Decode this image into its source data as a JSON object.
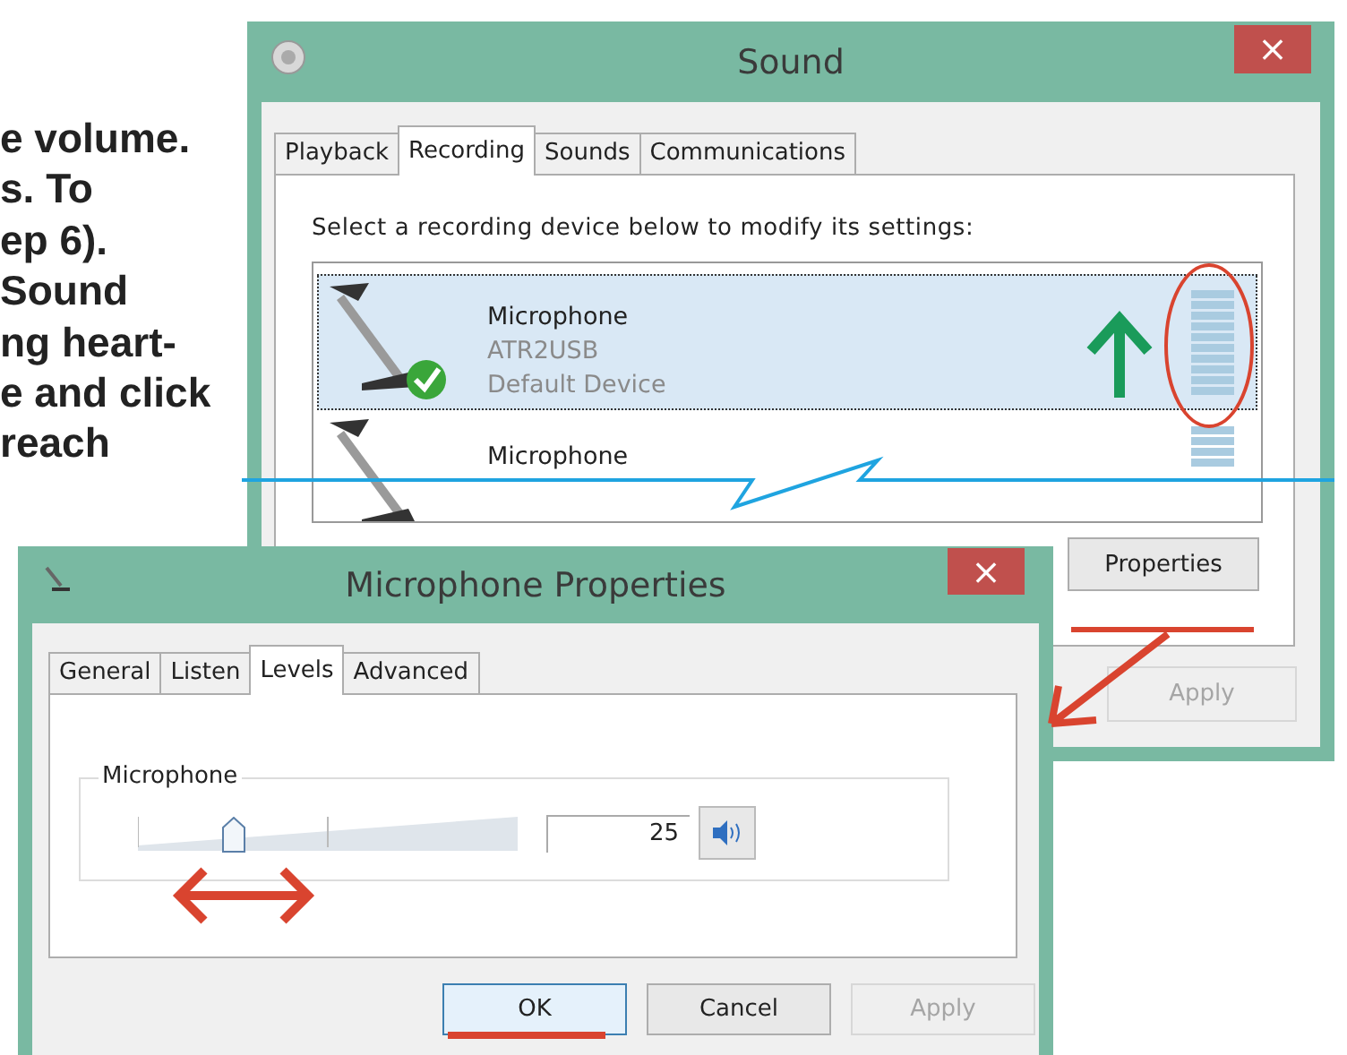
{
  "article_lines": [
    "e volume.",
    "s. To",
    "ep 6).",
    "Sound",
    "ng heart-",
    "e and click",
    "reach"
  ],
  "sound_window": {
    "title": "Sound",
    "close": "×",
    "tabs": [
      {
        "label": "Playback",
        "selected": false
      },
      {
        "label": "Recording",
        "selected": true
      },
      {
        "label": "Sounds",
        "selected": false
      },
      {
        "label": "Communications",
        "selected": false
      }
    ],
    "instruction": "Select a recording device below to modify its settings:",
    "devices": [
      {
        "name": "Microphone",
        "lines": [
          "ATR2USB",
          "Default Device"
        ],
        "selected": true,
        "default": true
      },
      {
        "name": "Microphone",
        "selected": false,
        "default": false
      }
    ],
    "buttons": [
      {
        "label": "Properties",
        "kind": "panel",
        "disabled": false
      },
      {
        "label": "Apply",
        "kind": "dialog",
        "disabled": true
      }
    ]
  },
  "properties_window": {
    "title": "Microphone Properties",
    "close": "×",
    "tabs": [
      {
        "label": "General",
        "selected": false
      },
      {
        "label": "Listen",
        "selected": false
      },
      {
        "label": "Levels",
        "selected": true
      },
      {
        "label": "Advanced",
        "selected": false
      }
    ],
    "group": {
      "label": "Microphone",
      "level": 0.25,
      "value": "25",
      "muted": false
    },
    "buttons": [
      {
        "label": "OK",
        "default": true,
        "disabled": false
      },
      {
        "label": "Cancel",
        "default": false,
        "disabled": false
      },
      {
        "label": "Apply",
        "default": false,
        "disabled": true
      }
    ]
  }
}
